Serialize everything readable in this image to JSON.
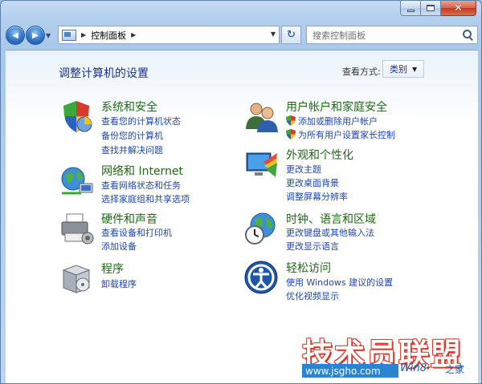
{
  "window": {
    "caption": {
      "close_glyph": "✕"
    }
  },
  "nav": {
    "back_glyph": "◀",
    "forward_glyph": "▶",
    "address_path": "控制面板",
    "search_placeholder": "搜索控制面板",
    "refresh_glyph": "↻"
  },
  "header": {
    "title": "调整计算机的设置",
    "view_by_label": "查看方式:",
    "view_by_value": "类别"
  },
  "categories": [
    {
      "title": "系统和安全",
      "links": [
        "查看您的计算机状态",
        "备份您的计算机",
        "查找并解决问题"
      ]
    },
    {
      "title": "网络和 Internet",
      "links": [
        "查看网络状态和任务",
        "选择家庭组和共享选项"
      ]
    },
    {
      "title": "硬件和声音",
      "links": [
        "查看设备和打印机",
        "添加设备"
      ]
    },
    {
      "title": "程序",
      "links": [
        "卸载程序"
      ]
    },
    {
      "title": "用户帐户和家庭安全",
      "links": [
        "添加或删除用户帐户",
        "为所有用户设置家长控制"
      ]
    },
    {
      "title": "外观和个性化",
      "links": [
        "更改主题",
        "更改桌面背景",
        "调整屏幕分辨率"
      ]
    },
    {
      "title": "时钟、语言和区域",
      "links": [
        "更改键盘或其他输入法",
        "更改显示语言"
      ]
    },
    {
      "title": "轻松访问",
      "links": [
        "使用 Windows 建议的设置",
        "优化视频显示"
      ]
    }
  ],
  "watermark": {
    "main": "技术员联盟",
    "site": "www.jsgho.com",
    "win_text": "Win8",
    "home_text": "之家"
  },
  "colors": {
    "category_title": "#1d6b14",
    "link": "#1d47b0",
    "page_title": "#1e3287"
  }
}
